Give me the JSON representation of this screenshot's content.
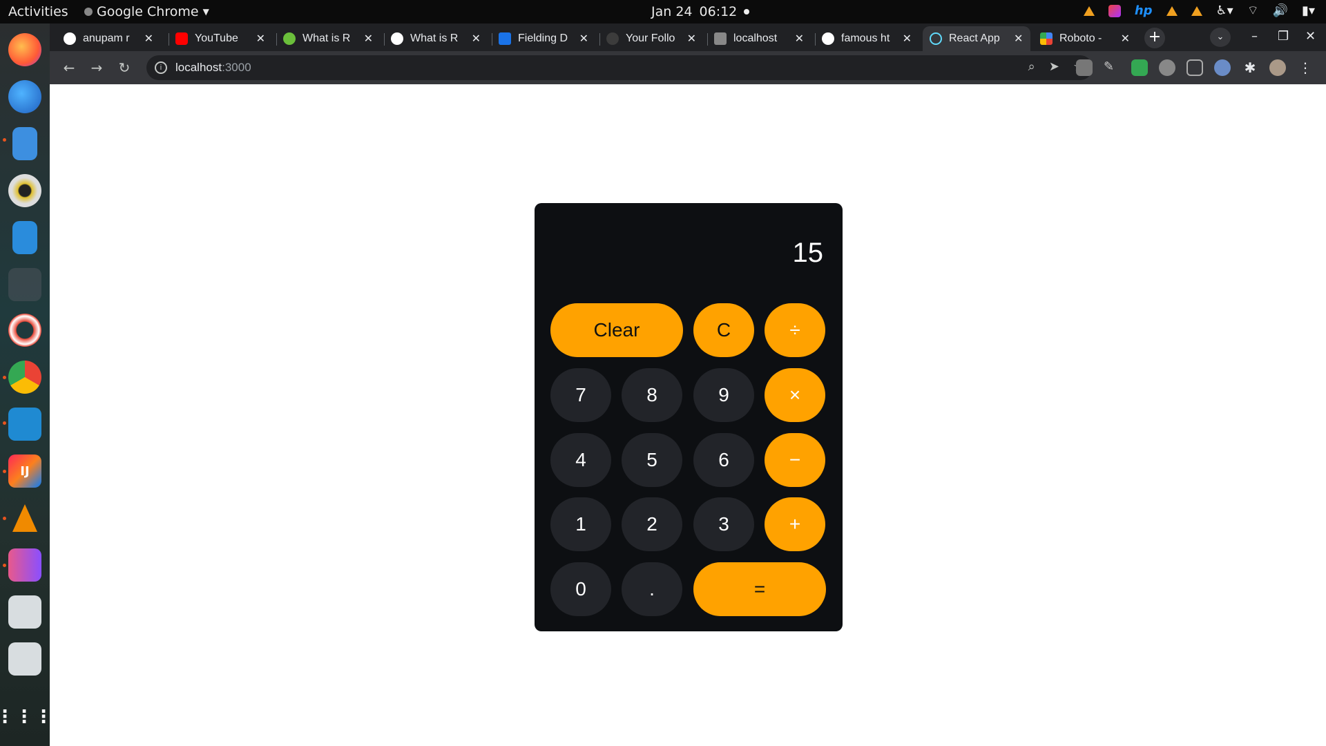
{
  "topbar": {
    "activities": "Activities",
    "app_name": "Google Chrome",
    "date": "Jan 24",
    "time": "06:12"
  },
  "dock": {
    "items": [
      "firefox-icon",
      "thunderbird-icon",
      "notes-icon",
      "rhythmbox-icon",
      "libreoffice-writer-icon",
      "screenshot-icon",
      "help-icon",
      "chrome-icon",
      "vscode-icon",
      "intellij-icon",
      "vlc-icon",
      "media-icon",
      "drive-icon",
      "drive-icon",
      "show-apps-icon"
    ]
  },
  "browser": {
    "tabs": [
      {
        "title": "anupam r",
        "fav_color": "#ffffff"
      },
      {
        "title": "YouTube",
        "fav_color": "#ff0000"
      },
      {
        "title": "What is R",
        "fav_color": "#6bbf3b"
      },
      {
        "title": "What is R",
        "fav_color": "#ffffff"
      },
      {
        "title": "Fielding D",
        "fav_color": "#1a73e8"
      },
      {
        "title": "Your Follo",
        "fav_color": "#3c3c3c"
      },
      {
        "title": "localhost",
        "fav_color": "#888888"
      },
      {
        "title": "famous ht",
        "fav_color": "#ffffff"
      },
      {
        "title": "React App",
        "fav_color": "#61dafb"
      },
      {
        "title": "Roboto - ",
        "fav_color": "#4285f4"
      }
    ],
    "url_host": "localhost",
    "url_port": ":3000"
  },
  "calculator": {
    "display": "15",
    "keys": {
      "clear": "Clear",
      "c": "C",
      "divide": "÷",
      "seven": "7",
      "eight": "8",
      "nine": "9",
      "multiply": "×",
      "four": "4",
      "five": "5",
      "six": "6",
      "minus": "−",
      "one": "1",
      "two": "2",
      "three": "3",
      "plus": "+",
      "zero": "0",
      "dot": ".",
      "equals": "="
    }
  }
}
